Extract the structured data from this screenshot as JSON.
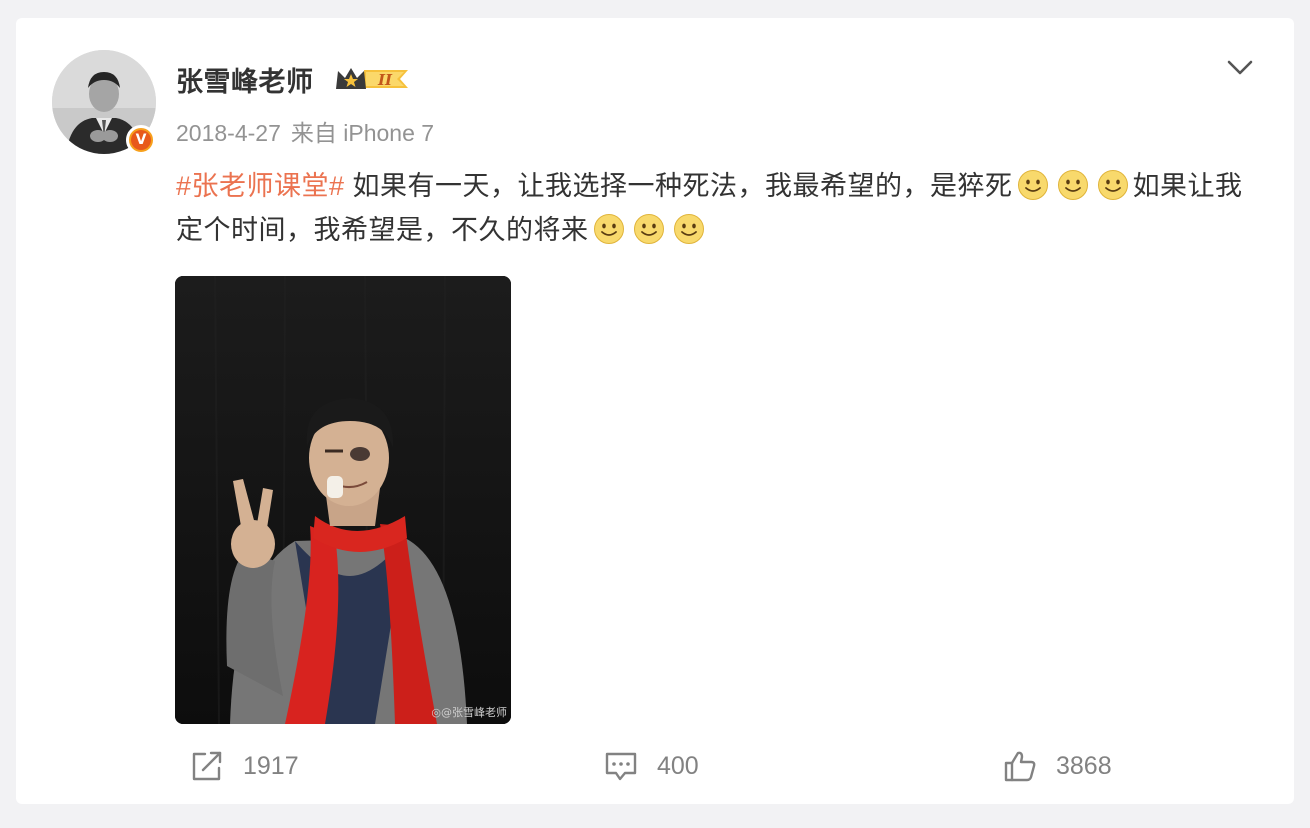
{
  "post": {
    "author": {
      "name": "张雪峰老师",
      "verified_badge": "V",
      "vip_level": "II"
    },
    "meta": {
      "date": "2018-4-27",
      "source": "来自 iPhone 7"
    },
    "content": {
      "topic": "#张老师课堂#",
      "text_part1": " 如果有一天，让我选择一种死法，我最希望的，是猝死",
      "text_part2": "如果让我定个时间，我希望是，不久的将来"
    },
    "image": {
      "watermark": "◎@张雪峰老师"
    },
    "stats": {
      "reposts": "1917",
      "comments": "400",
      "likes": "3868"
    }
  },
  "icons": {
    "menu": "chevron-down-icon",
    "repost": "repost-icon",
    "comment": "comment-icon",
    "like": "thumbs-up-icon",
    "emoji": "smile-emoji-icon"
  },
  "colors": {
    "topic": "#eb7350",
    "text": "#333333",
    "meta": "#939393",
    "action": "#828282",
    "badge_orange": "#f7a01c",
    "badge_red": "#e8591a"
  }
}
